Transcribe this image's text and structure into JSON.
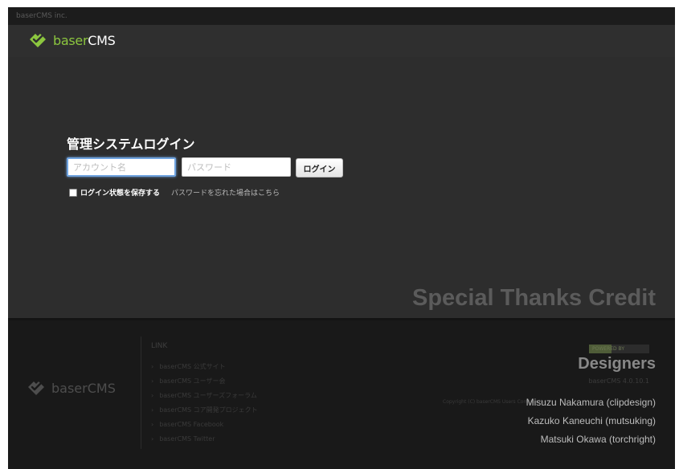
{
  "topbar": {
    "company": "baserCMS inc."
  },
  "brand": {
    "part_a": "baser",
    "part_b": "CMS",
    "accent": "#8cc63f"
  },
  "login": {
    "title": "管理システムログイン",
    "account_placeholder": "アカウント名",
    "password_placeholder": "パスワード",
    "submit_label": "ログイン",
    "remember_label": "ログイン状態を保存する",
    "forgot_link": "パスワードを忘れた場合はこちら"
  },
  "credit": {
    "title": "Special Thanks Credit"
  },
  "footer": {
    "link_title": "LINK",
    "links": [
      {
        "arrow": "›",
        "label": "baserCMS 公式サイト"
      },
      {
        "arrow": "›",
        "label": "baserCMS ユーザー会"
      },
      {
        "arrow": "›",
        "label": "baserCMS ユーザーズフォーラム"
      },
      {
        "arrow": "›",
        "label": "baserCMS コア開発プロジェクト"
      },
      {
        "arrow": "›",
        "label": "baserCMS Facebook"
      },
      {
        "arrow": "›",
        "label": "baserCMS Twitter"
      }
    ],
    "badge_text": "POWERED BY",
    "designers_title": "Designers",
    "version": "baserCMS 4.0.10.1",
    "copyright": "Copyright (C) baserCMS Users Community",
    "designers": [
      "Misuzu Nakamura (clipdesign)",
      "Kazuko Kaneuchi (mutsuking)",
      "Matsuki Okawa (torchright)"
    ]
  }
}
